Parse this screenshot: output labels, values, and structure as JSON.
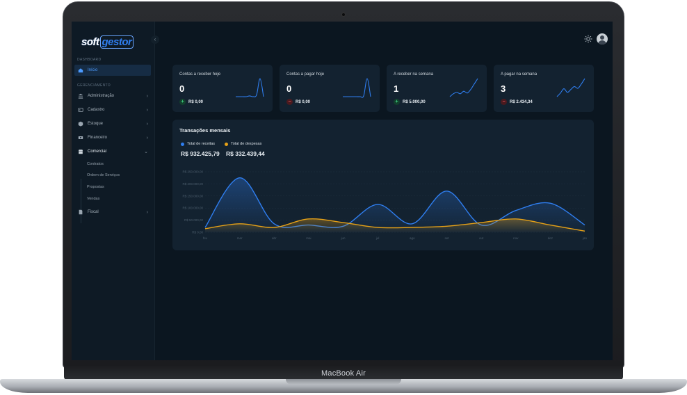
{
  "device": {
    "label": "MacBook Air"
  },
  "sidebar": {
    "logo": {
      "soft": "soft",
      "gestor": "gestor"
    },
    "collapse_icon": "chevron-left-icon",
    "section_dashboard": "DASHBOARD",
    "section_management": "GERENCIAMENTO",
    "items": [
      {
        "label": "Início",
        "icon": "home-icon",
        "active": true
      },
      {
        "label": "Administração",
        "icon": "bank-icon"
      },
      {
        "label": "Cadastro",
        "icon": "id-card-icon"
      },
      {
        "label": "Estoque",
        "icon": "box-icon"
      },
      {
        "label": "Financeiro",
        "icon": "money-icon"
      },
      {
        "label": "Comercial",
        "icon": "shop-icon",
        "open": true
      },
      {
        "label": "Fiscal",
        "icon": "document-icon"
      }
    ],
    "sub_items": [
      "Contratos",
      "Ordem de Serviços",
      "Propostas",
      "Vendas"
    ]
  },
  "topbar": {
    "theme_icon": "sun-icon",
    "avatar_icon": "user-avatar-icon"
  },
  "cards": [
    {
      "title": "Contas a receber hoje",
      "count": "0",
      "amount": "R$ 0,00",
      "trend": "up",
      "badge": "+",
      "spark": [
        1,
        1,
        1,
        1,
        1.2,
        1,
        1.5,
        6,
        1
      ]
    },
    {
      "title": "Contas a pagar hoje",
      "count": "0",
      "amount": "R$ 0,00",
      "trend": "down",
      "badge": "−",
      "spark": [
        1,
        1,
        1,
        1,
        1,
        1,
        1.2,
        6,
        1
      ]
    },
    {
      "title": "A receber na semana",
      "count": "1",
      "amount": "R$ 5.000,00",
      "trend": "up",
      "badge": "+",
      "spark": [
        1,
        1.8,
        2.2,
        1.8,
        2.5,
        2,
        3,
        4.5,
        6
      ]
    },
    {
      "title": "A pagar na semana",
      "count": "3",
      "amount": "R$ 2.434,34",
      "trend": "down",
      "badge": "−",
      "spark": [
        1,
        2,
        3.2,
        2.2,
        3,
        3.8,
        3.3,
        4.5,
        6
      ]
    }
  ],
  "colors": {
    "receitas": "#2f7ef0",
    "despesas": "#e6a117",
    "accent": "#4c9bff"
  },
  "chart_panel": {
    "title": "Transações mensais",
    "legend": [
      {
        "label": "Total de receitas",
        "value": "R$ 932.425,79"
      },
      {
        "label": "Total de despesas",
        "value": "R$ 332.439,44"
      }
    ]
  },
  "chart_data": {
    "type": "area",
    "categories": [
      "fev",
      "mar",
      "abr",
      "mai",
      "jun",
      "jul",
      "ago",
      "set",
      "out",
      "nov",
      "dez",
      "jan"
    ],
    "y_tick_labels": [
      "R$ 0,00",
      "R$ 50.000,00",
      "R$ 100.000,00",
      "R$ 150.000,00",
      "R$ 200.000,00",
      "R$ 250.000,00"
    ],
    "ylim": [
      0,
      250000
    ],
    "grid": true,
    "series": [
      {
        "name": "Total de receitas",
        "values": [
          20000,
          225000,
          35000,
          30000,
          25000,
          115000,
          35000,
          170000,
          30000,
          90000,
          120000,
          30000
        ]
      },
      {
        "name": "Total de despesas",
        "values": [
          15000,
          35000,
          20000,
          55000,
          40000,
          20000,
          20000,
          25000,
          40000,
          55000,
          30000,
          5000
        ]
      }
    ]
  }
}
